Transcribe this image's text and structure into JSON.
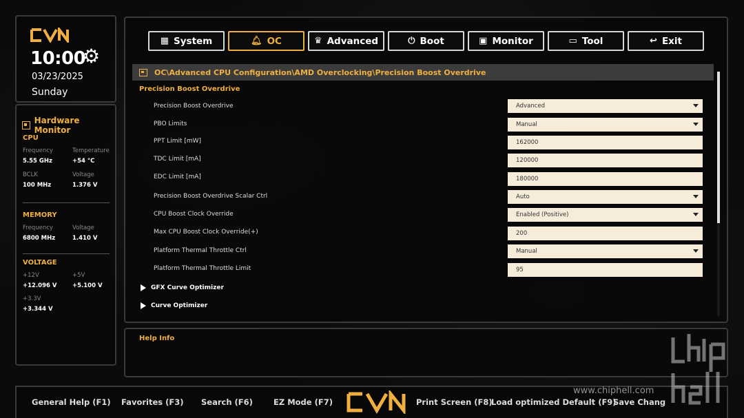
{
  "brand": {
    "logo_text": "CVN"
  },
  "clock": {
    "time": "10:00",
    "date": "03/23/2025",
    "day": "Sunday"
  },
  "hardware_monitor": {
    "title": "Hardware Monitor",
    "cpu": {
      "title": "CPU",
      "frequency_label": "Frequency",
      "frequency": "5.55 GHz",
      "temperature_label": "Temperature",
      "temperature": "+54 °C",
      "bclk_label": "BCLK",
      "bclk": "100 MHz",
      "voltage_label": "Voltage",
      "voltage": "1.376 V"
    },
    "memory": {
      "title": "MEMORY",
      "frequency_label": "Frequency",
      "frequency": "6800 MHz",
      "voltage_label": "Voltage",
      "voltage": "1.410 V"
    },
    "voltage": {
      "title": "VOLTAGE",
      "v12_label": "+12V",
      "v12": "+12.096 V",
      "v5_label": "+5V",
      "v5": "+5.100 V",
      "v33_label": "+3.3V",
      "v33": "+3.344 V"
    }
  },
  "tabs": [
    {
      "label": "System",
      "icon": "grid-icon"
    },
    {
      "label": "OC",
      "icon": "bell-icon",
      "active": true
    },
    {
      "label": "Advanced",
      "icon": "crown-icon"
    },
    {
      "label": "Boot",
      "icon": "power-icon"
    },
    {
      "label": "Monitor",
      "icon": "monitor-icon"
    },
    {
      "label": "Tool",
      "icon": "toolbox-icon"
    },
    {
      "label": "Exit",
      "icon": "back-arrow-icon"
    }
  ],
  "breadcrumb": "OC\\Advanced CPU Configuration\\AMD Overclocking\\Precision Boost Overdrive",
  "section_title": "Precision Boost Overdrive",
  "settings": [
    {
      "label": "Precision Boost Overdrive",
      "value": "Advanced",
      "type": "dropdown"
    },
    {
      "label": "PBO Limits",
      "value": "Manual",
      "type": "dropdown"
    },
    {
      "label": "PPT Limit [mW]",
      "value": "162000",
      "type": "input"
    },
    {
      "label": "TDC Limit [mA]",
      "value": "120000",
      "type": "input"
    },
    {
      "label": "EDC Limit [mA]",
      "value": "180000",
      "type": "input"
    },
    {
      "label": "Precision Boost Overdrive Scalar Ctrl",
      "value": "Auto",
      "type": "dropdown"
    },
    {
      "label": "CPU Boost Clock Override",
      "value": "Enabled (Positive)",
      "type": "dropdown"
    },
    {
      "label": "Max CPU Boost Clock Override(+)",
      "value": "200",
      "type": "input"
    },
    {
      "label": "Platform Thermal Throttle Ctrl",
      "value": "Manual",
      "type": "dropdown"
    },
    {
      "label": "Platform Thermal Throttle Limit",
      "value": "95",
      "type": "input"
    }
  ],
  "submenus": [
    "GFX Curve Optimizer",
    "Curve Optimizer"
  ],
  "help": {
    "title": "Help Info"
  },
  "footer": {
    "general_help": "General Help (F1)",
    "favorites": "Favorites (F3)",
    "search": "Search (F6)",
    "ez_mode": "EZ Mode (F7)",
    "print_screen": "Print Screen (F8)",
    "load_defaults": "Load optimized Default (F9)",
    "save_changes": "Save Chang"
  },
  "watermark": "www.chiphell.com",
  "colors": {
    "accent": "#f0b040",
    "field_bg": "#f6ecd9",
    "panel_border": "#3a3a3a"
  }
}
